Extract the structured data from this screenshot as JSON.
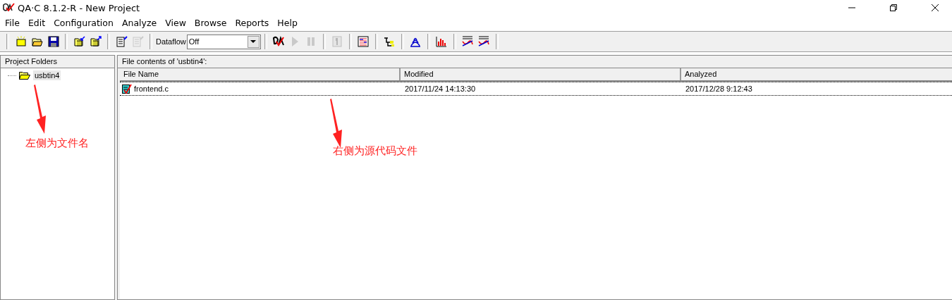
{
  "window": {
    "title": "QA·C 8.1.2-R - New Project"
  },
  "menu": [
    "File",
    "Edit",
    "Configuration",
    "Analyze",
    "View",
    "Browse",
    "Reports",
    "Help"
  ],
  "toolbar": [
    {
      "kind": "group",
      "buttons": [
        {
          "disabled": false
        },
        {
          "disabled": false
        },
        {
          "disabled": false
        }
      ]
    },
    {
      "kind": "group",
      "buttons": [
        {
          "disabled": false
        },
        {
          "disabled": false
        }
      ]
    },
    {
      "kind": "group",
      "buttons": [
        {
          "disabled": false
        },
        {
          "disabled": true
        }
      ]
    },
    {
      "kind": "dropdown",
      "label": "Dataflow",
      "value": "Off"
    },
    {
      "kind": "group",
      "buttons": [
        {
          "disabled": false
        },
        {
          "disabled": true
        },
        {
          "disabled": true
        }
      ]
    },
    {
      "kind": "group",
      "buttons": [
        {
          "disabled": true
        }
      ]
    },
    {
      "kind": "group",
      "buttons": [
        {
          "disabled": false
        }
      ]
    },
    {
      "kind": "group",
      "buttons": [
        {
          "disabled": false
        }
      ]
    },
    {
      "kind": "group",
      "buttons": [
        {
          "disabled": false
        }
      ]
    },
    {
      "kind": "group",
      "buttons": [
        {
          "disabled": false
        }
      ]
    },
    {
      "kind": "group",
      "buttons": [
        {
          "disabled": false
        },
        {
          "disabled": false
        }
      ]
    }
  ],
  "sidebar": {
    "title": "Project Folders",
    "items": [
      {
        "label": "usbtin4",
        "selected": true
      }
    ]
  },
  "file_list": {
    "title": "File contents of  'usbtin4':",
    "columns": [
      "File Name",
      "Modified",
      "Analyzed"
    ],
    "rows": [
      {
        "cells": [
          "frontend.c",
          "2017/11/24 14:13:30",
          "2017/12/28 9:12:43"
        ],
        "selected": true
      }
    ]
  },
  "annotations": [
    {
      "text": "左侧为文件名"
    },
    {
      "text": "右侧为源代码文件"
    }
  ]
}
